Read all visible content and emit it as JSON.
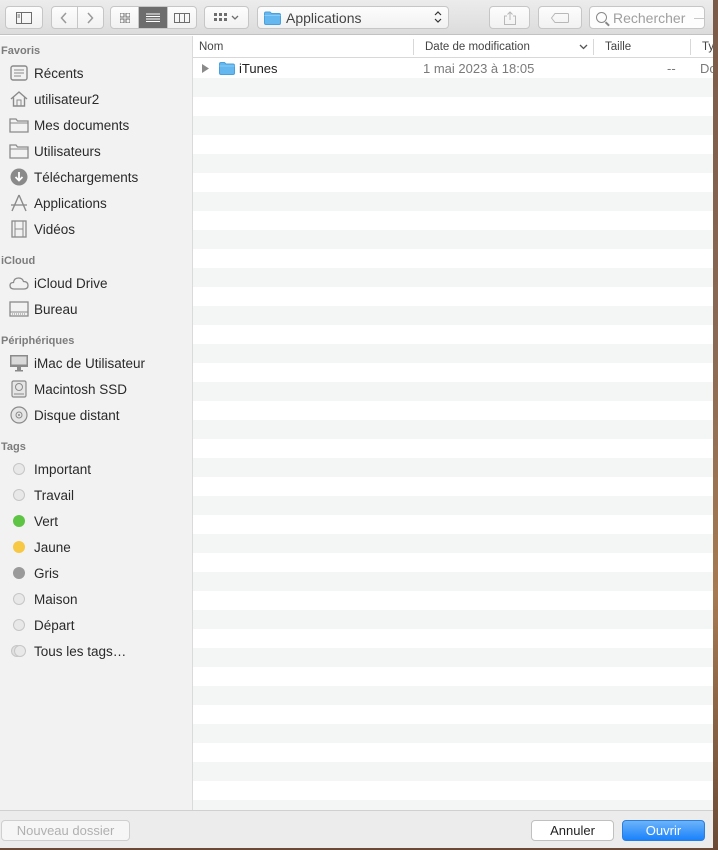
{
  "toolbar": {
    "path_label": "Applications",
    "search_placeholder": "Rechercher"
  },
  "sidebar": {
    "sections": [
      {
        "title": "Favoris",
        "items": [
          {
            "label": "Récents",
            "icon": "clock-icon"
          },
          {
            "label": "utilisateur2",
            "icon": "home-icon"
          },
          {
            "label": "Mes documents",
            "icon": "folder-icon"
          },
          {
            "label": "Utilisateurs",
            "icon": "folder-icon"
          },
          {
            "label": "Téléchargements",
            "icon": "download-icon"
          },
          {
            "label": "Applications",
            "icon": "applications-icon"
          },
          {
            "label": "Vidéos",
            "icon": "film-icon"
          }
        ]
      },
      {
        "title": "iCloud",
        "items": [
          {
            "label": "iCloud Drive",
            "icon": "cloud-icon"
          },
          {
            "label": "Bureau",
            "icon": "desktop-icon"
          }
        ]
      },
      {
        "title": "Périphériques",
        "items": [
          {
            "label": "iMac de Utilisateur",
            "icon": "imac-icon"
          },
          {
            "label": "Macintosh SSD",
            "icon": "disk-icon"
          },
          {
            "label": "Disque distant",
            "icon": "optical-disc-icon"
          }
        ]
      },
      {
        "title": "Tags",
        "items": [
          {
            "label": "Important",
            "color": "#e0e0e0"
          },
          {
            "label": "Travail",
            "color": "#e0e0e0"
          },
          {
            "label": "Vert",
            "color": "#5ec544"
          },
          {
            "label": "Jaune",
            "color": "#f7c843"
          },
          {
            "label": "Gris",
            "color": "#9a9a9a"
          },
          {
            "label": "Maison",
            "color": "#e0e0e0"
          },
          {
            "label": "Départ",
            "color": "#e0e0e0"
          },
          {
            "label": "Tous les tags…",
            "color": "#e0e0e0"
          }
        ]
      }
    ]
  },
  "list": {
    "columns": {
      "name": "Nom",
      "date": "Date de modification",
      "size": "Taille",
      "type": "Ty"
    },
    "rows": [
      {
        "name": "iTunes",
        "date": "1 mai 2023 à 18:05",
        "size": "--",
        "type": "Do"
      }
    ]
  },
  "bottom": {
    "new_folder": "Nouveau dossier",
    "cancel": "Annuler",
    "open": "Ouvrir"
  },
  "colors": {
    "accent": "#1a82fb",
    "folder": "#5fb6ee"
  }
}
